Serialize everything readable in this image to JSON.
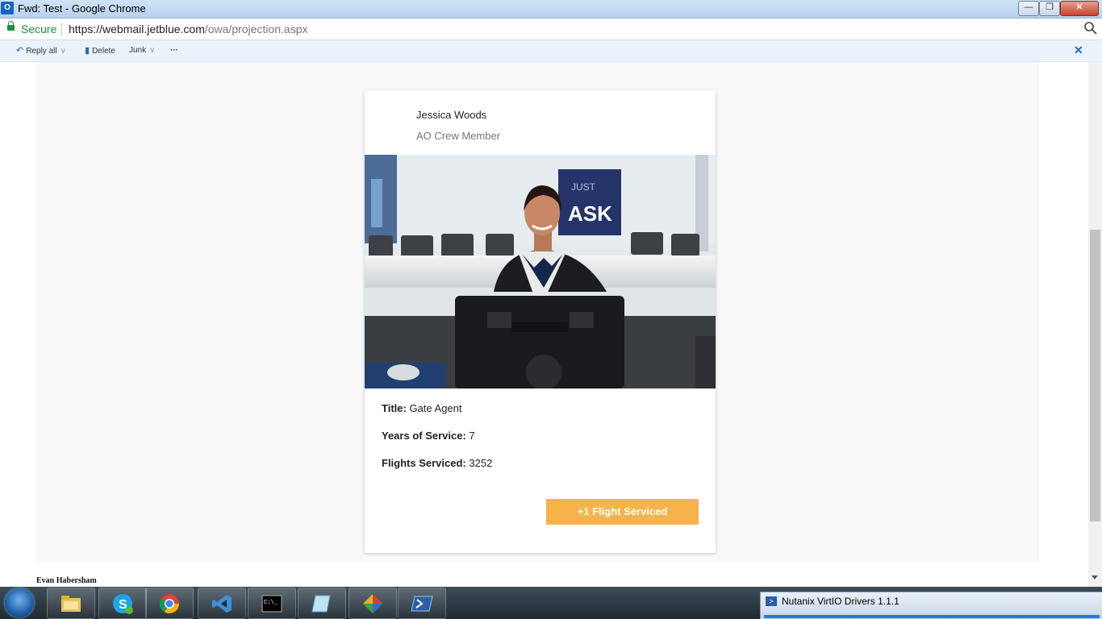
{
  "window": {
    "title": "Fwd: Test - Google Chrome",
    "app_icon": "O⃞",
    "controls": {
      "minimize": "—",
      "maximize": "❐",
      "close": "✕"
    }
  },
  "addressbar": {
    "secure_label": "Secure",
    "url_host": "https://webmail.jetblue.com",
    "url_path": "/owa/projection.aspx"
  },
  "toolbar": {
    "reply_all": "Reply all",
    "delete": "Delete",
    "junk": "Junk",
    "more": "···",
    "close": "✕",
    "split_glyph": "∨"
  },
  "card": {
    "name": "Jessica Woods",
    "role": "AO Crew Member",
    "title_label": "Title:",
    "title_value": "Gate Agent",
    "years_label": "Years of Service:",
    "years_value": "7",
    "flights_label": "Flights Serviced:",
    "flights_value": "3252",
    "button_label": "+1 Flight Serviced",
    "photo_sign_text": "ASK",
    "photo_sign_text_small": "JUST"
  },
  "signature": "Evan Habersham",
  "taskbar": {
    "popup_label": "Nutanix VirtIO Drivers 1.1.1",
    "items": [
      "file-explorer",
      "skype",
      "chrome",
      "visual-studio",
      "command-prompt",
      "notepad",
      "paint",
      "powershell"
    ]
  },
  "colors": {
    "accent_button": "#f6b34a",
    "secure_green": "#1e8e3e",
    "toolbar_bg": "#eaf3fb"
  }
}
